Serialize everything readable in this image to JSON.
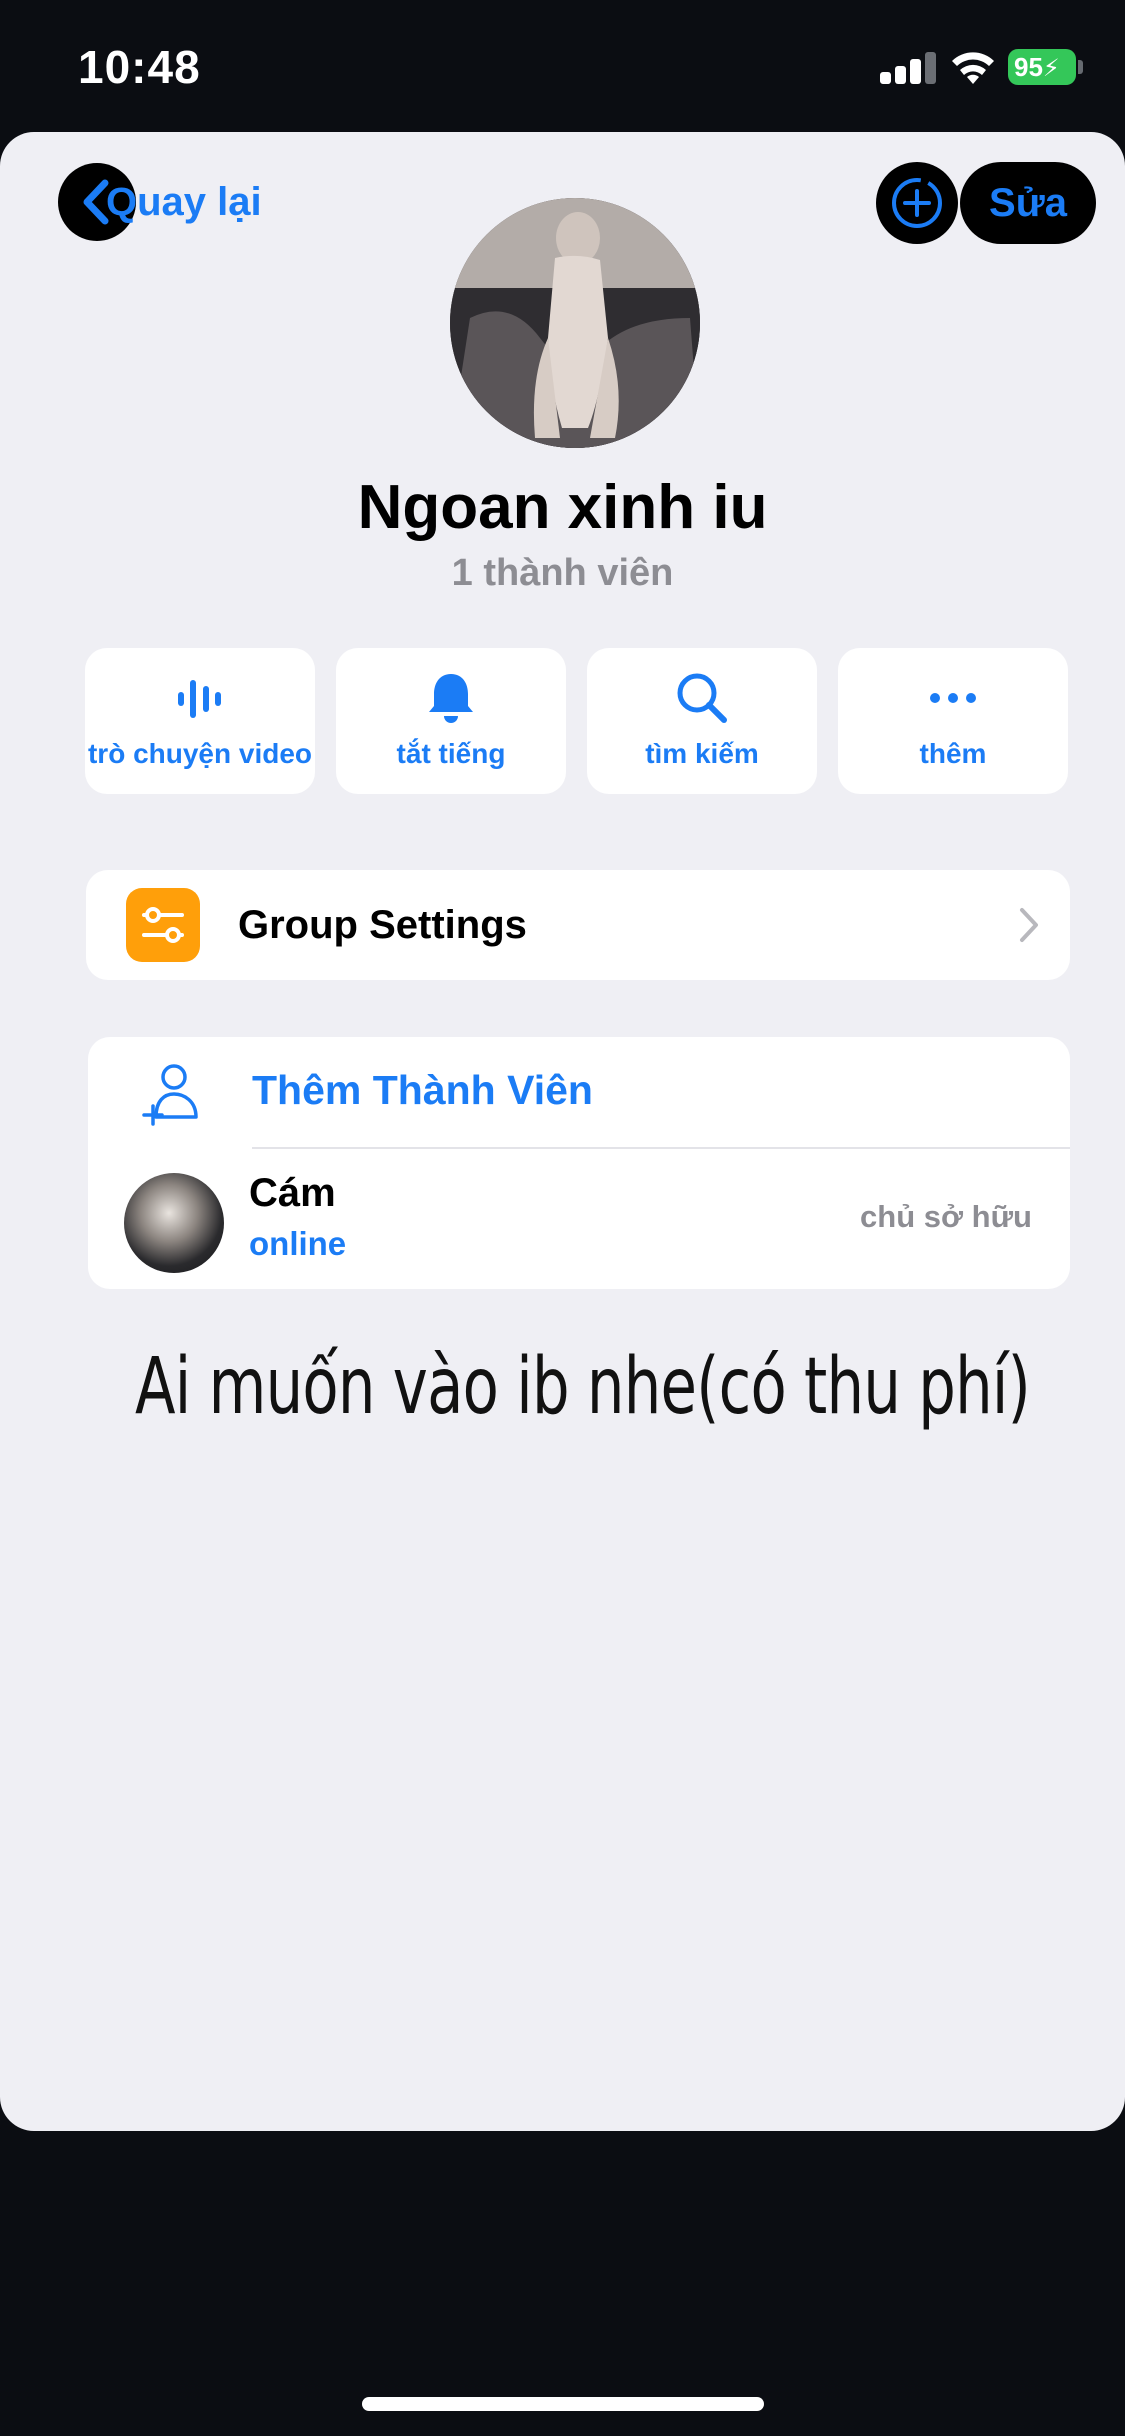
{
  "status_bar": {
    "time": "10:48",
    "battery": "95",
    "battery_color": "#34c759"
  },
  "nav": {
    "back_label": "Quay lại",
    "edit_label": "Sửa",
    "back_icon": "chevron-left-icon",
    "add_icon": "add-circle-icon"
  },
  "group": {
    "name": "Ngoan xinh iu",
    "member_count": "1 thành viên"
  },
  "actions": [
    {
      "label": "trò chuyện video",
      "icon": "voice-chat-icon"
    },
    {
      "label": "tắt tiếng",
      "icon": "bell-icon"
    },
    {
      "label": "tìm kiếm",
      "icon": "search-icon"
    },
    {
      "label": "thêm",
      "icon": "more-icon"
    }
  ],
  "settings": {
    "label": "Group Settings",
    "icon": "sliders-icon",
    "icon_color": "#ff9f0a"
  },
  "members": {
    "add_label": "Thêm Thành Viên",
    "list": [
      {
        "name": "Cám",
        "status": "online",
        "role": "chủ sở hữu"
      }
    ]
  },
  "caption": "Ai muốn vào ib nhe(có thu phí)",
  "colors": {
    "accent": "#1b7cf5",
    "background": "#efeff4",
    "frame": "#0b0d12"
  }
}
